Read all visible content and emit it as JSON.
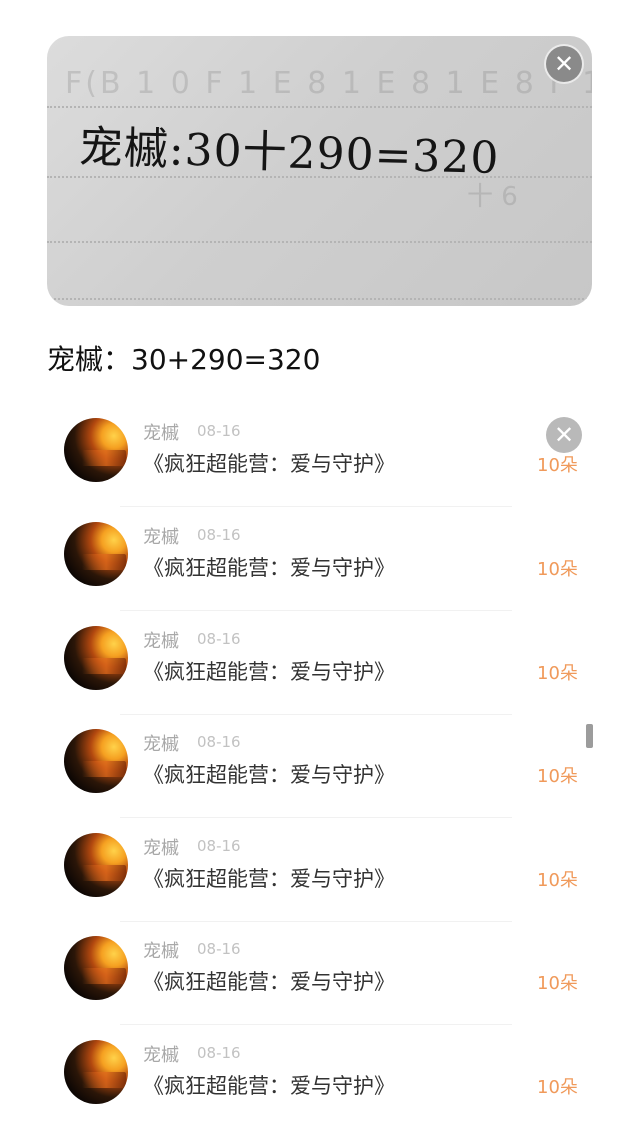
{
  "photo": {
    "handwriting": "宠槭:30十290=320",
    "ghost_text": "F(B 1 0 F 1 E 8 1 E 8 1 E 8 F 1",
    "ghost_text2": "十 6"
  },
  "caption": "宠槭：30+290=320",
  "icons": {
    "close": "close-icon"
  },
  "items": [
    {
      "name": "宠槭",
      "date": "08-16",
      "title": "《疯狂超能营：爱与守护》",
      "amount": "10朵"
    },
    {
      "name": "宠槭",
      "date": "08-16",
      "title": "《疯狂超能营：爱与守护》",
      "amount": "10朵"
    },
    {
      "name": "宠槭",
      "date": "08-16",
      "title": "《疯狂超能营：爱与守护》",
      "amount": "10朵"
    },
    {
      "name": "宠槭",
      "date": "08-16",
      "title": "《疯狂超能营：爱与守护》",
      "amount": "10朵"
    },
    {
      "name": "宠槭",
      "date": "08-16",
      "title": "《疯狂超能营：爱与守护》",
      "amount": "10朵"
    },
    {
      "name": "宠槭",
      "date": "08-16",
      "title": "《疯狂超能营：爱与守护》",
      "amount": "10朵"
    },
    {
      "name": "宠槭",
      "date": "08-16",
      "title": "《疯狂超能营：爱与守护》",
      "amount": "10朵"
    }
  ],
  "colors": {
    "amount": "#f09a5b",
    "name": "#a8a8a8",
    "title": "#333333"
  }
}
